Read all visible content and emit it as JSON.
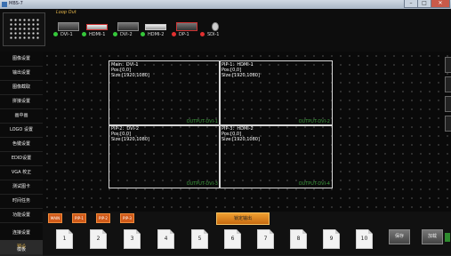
{
  "window": {
    "title": "MBS-7"
  },
  "topbar": {
    "loop_out_label": "Loop Out",
    "inputs": [
      {
        "label": "DVI-1",
        "color": "#35c83a"
      },
      {
        "label": "HDMI-1",
        "color": "#35c83a"
      },
      {
        "label": "DVI-2",
        "color": "#35c83a"
      },
      {
        "label": "HDMI-2",
        "color": "#35c83a"
      },
      {
        "label": "DP-1",
        "color": "#e23030"
      },
      {
        "label": "SDI-1",
        "color": "#e23030"
      }
    ]
  },
  "sidebar": {
    "items": [
      {
        "label": "图像设置"
      },
      {
        "label": "输出设置"
      },
      {
        "label": "图像截取"
      },
      {
        "label": "拼接设置"
      },
      {
        "label": "画中画"
      },
      {
        "label": "LOGO 设置"
      },
      {
        "label": "色键设置"
      },
      {
        "label": "EDID设置"
      },
      {
        "label": "VGA 校正"
      },
      {
        "label": "测试图卡"
      },
      {
        "label": "时间任务"
      },
      {
        "label": "功能设置"
      },
      {
        "label": "连接设置"
      },
      {
        "label": "预设"
      },
      {
        "label": "模板"
      }
    ]
  },
  "canvas": {
    "windows": [
      {
        "name": "Main：DVI-1",
        "pos": "Pos:[0,0]",
        "size": "Size:[1920,1080]",
        "output": "OUTPUT-DVI-1"
      },
      {
        "name": "PIP-1：HDMI-1",
        "pos": "Pos:[0,0]",
        "size": "Size:[1920,1080]",
        "output": "OUTPUT-DVI-2"
      },
      {
        "name": "PIP-2：DVI-2",
        "pos": "Pos:[0,0]",
        "size": "Size:[1920,1080]",
        "output": "OUTPUT-DVI-3"
      },
      {
        "name": "PIP-3：HDMI-2",
        "pos": "Pos:[0,0]",
        "size": "Size:[1920,1080]",
        "output": "OUTPUT-DVI-4"
      }
    ]
  },
  "toolbar": {
    "layers": [
      "MAIN",
      "PIP-1",
      "PIP-2",
      "PIP-3"
    ],
    "lock_label": "锁定输出",
    "presets": [
      "1",
      "2",
      "3",
      "4",
      "5",
      "6",
      "7",
      "8",
      "9",
      "10"
    ],
    "save_label": "保存",
    "load_label": "加载"
  }
}
